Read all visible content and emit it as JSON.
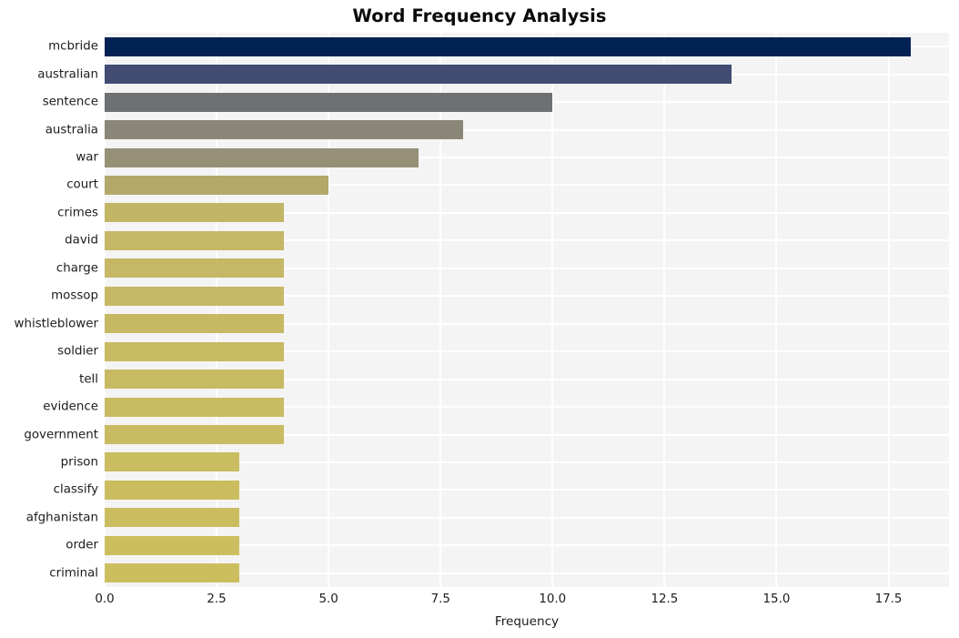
{
  "chart_data": {
    "type": "bar",
    "orientation": "horizontal",
    "title": "Word Frequency Analysis",
    "xlabel": "Frequency",
    "ylabel": "",
    "categories": [
      "mcbride",
      "australian",
      "sentence",
      "australia",
      "war",
      "court",
      "crimes",
      "david",
      "charge",
      "mossop",
      "whistleblower",
      "soldier",
      "tell",
      "evidence",
      "government",
      "prison",
      "classify",
      "afghanistan",
      "order",
      "criminal"
    ],
    "values": [
      18,
      14,
      10,
      8,
      7,
      5,
      4,
      4,
      4,
      4,
      4,
      4,
      4,
      4,
      4,
      3,
      3,
      3,
      3,
      3
    ],
    "bar_colors": [
      "#032254",
      "#414d73",
      "#6e7073",
      "#8a8779",
      "#969076",
      "#b3a86a",
      "#c2b566",
      "#c5b765",
      "#c5b765",
      "#c6b864",
      "#c7b963",
      "#c8ba62",
      "#c8ba62",
      "#c9bb61",
      "#c9bb61",
      "#cabc60",
      "#cbbd5f",
      "#cbbd5f",
      "#ccbe5e",
      "#ccbe5e"
    ],
    "xticks": [
      "0.0",
      "2.5",
      "5.0",
      "7.5",
      "10.0",
      "12.5",
      "15.0",
      "17.5"
    ],
    "xtick_values": [
      0,
      2.5,
      5,
      7.5,
      10,
      12.5,
      15,
      17.5
    ],
    "xlim": [
      0,
      18.85
    ],
    "grid": true,
    "legend": false,
    "plot_background": "#f4f4f5",
    "figure_background": "#ffffff",
    "gridline_color": "#ffffff",
    "text_color": "#1c1c1c",
    "title_color": "#0a0a0a"
  }
}
